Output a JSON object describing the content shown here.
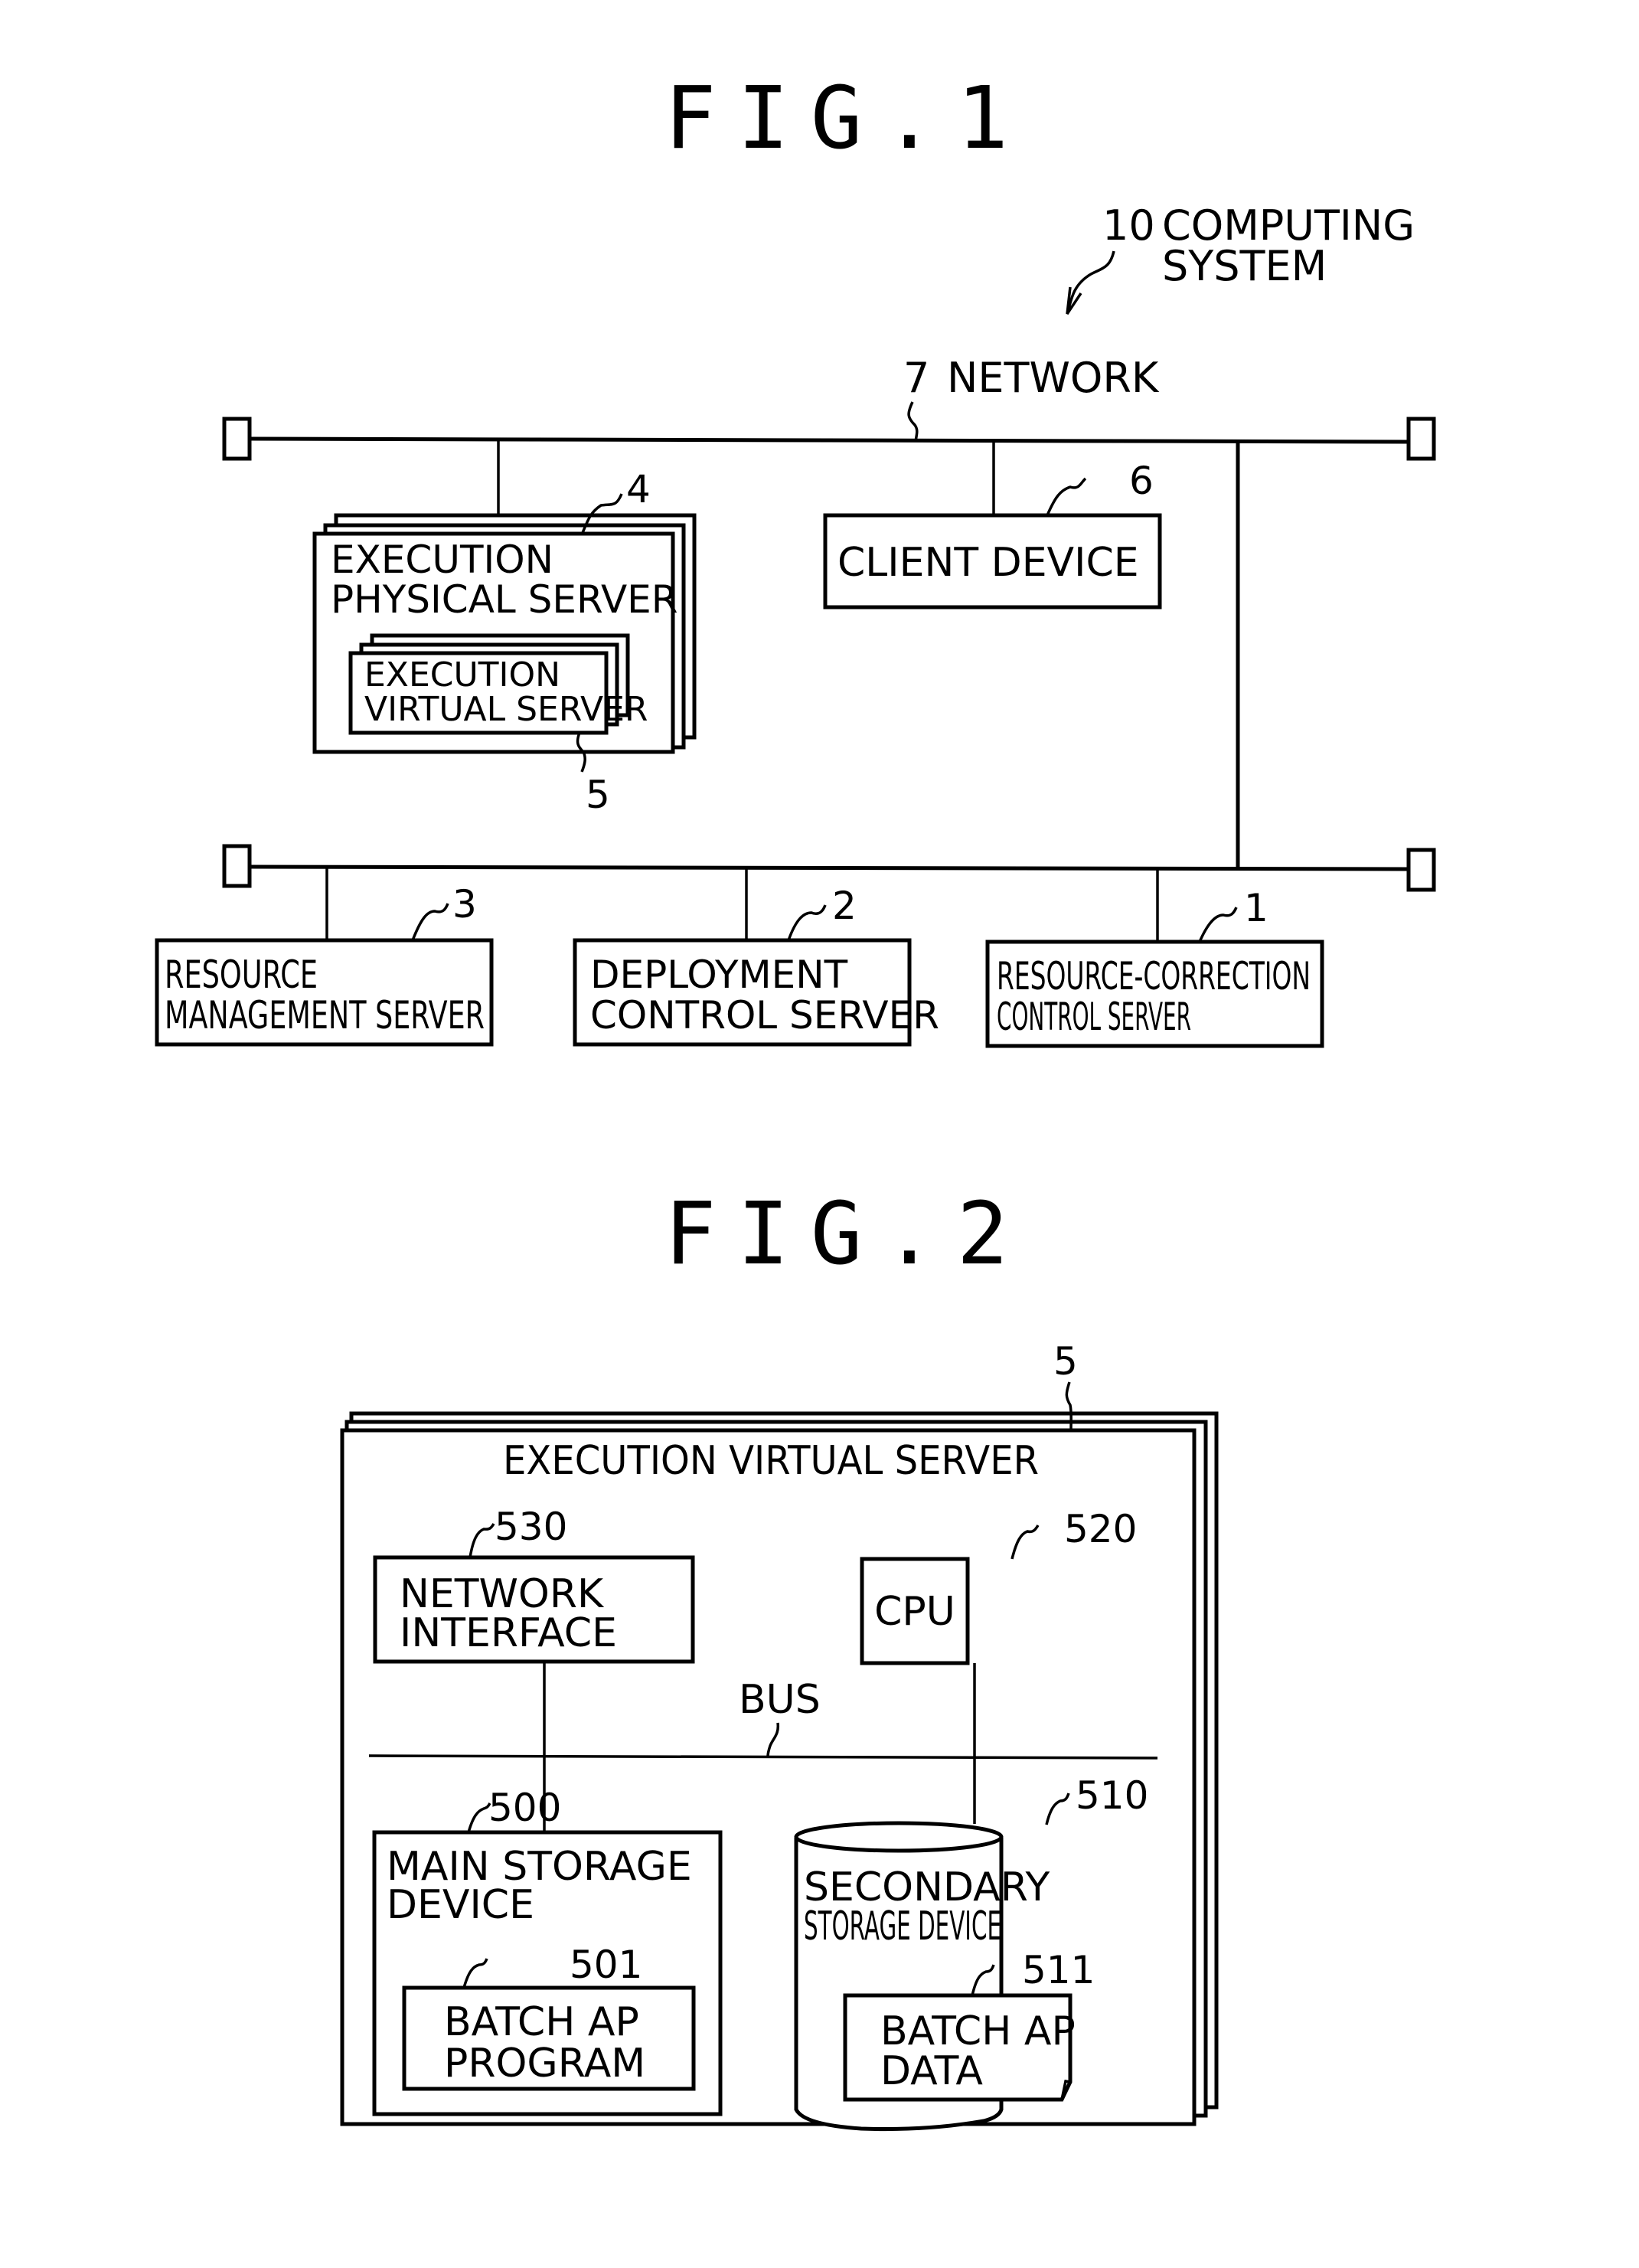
{
  "fig1": {
    "title": "FIG.1",
    "system": {
      "ref": "10",
      "label_line1": "COMPUTING",
      "label_line2": "SYSTEM"
    },
    "network": {
      "ref": "7",
      "label": "NETWORK"
    },
    "nodes": {
      "execution_physical_server": {
        "ref": "4",
        "line1": "EXECUTION",
        "line2": "PHYSICAL SERVER"
      },
      "execution_virtual_server": {
        "ref": "5",
        "line1": "EXECUTION",
        "line2": "VIRTUAL SERVER"
      },
      "client_device": {
        "ref": "6",
        "line1": "CLIENT DEVICE"
      },
      "resource_management_server": {
        "ref": "3",
        "line1": "RESOURCE",
        "line2": "MANAGEMENT SERVER"
      },
      "deployment_control_server": {
        "ref": "2",
        "line1": "DEPLOYMENT",
        "line2": "CONTROL SERVER"
      },
      "resource_correction_control_server": {
        "ref": "1",
        "line1": "RESOURCE-CORRECTION",
        "line2": "CONTROL SERVER"
      }
    }
  },
  "fig2": {
    "title": "FIG.2",
    "server": {
      "ref": "5",
      "label": "EXECUTION VIRTUAL SERVER"
    },
    "bus": {
      "label": "BUS"
    },
    "components": {
      "network_interface": {
        "ref": "530",
        "line1": "NETWORK",
        "line2": "INTERFACE"
      },
      "cpu": {
        "ref": "520",
        "line1": "CPU"
      },
      "main_storage": {
        "ref": "500",
        "line1": "MAIN STORAGE",
        "line2": "DEVICE"
      },
      "batch_ap_program": {
        "ref": "501",
        "line1": "BATCH AP",
        "line2": "PROGRAM"
      },
      "secondary_storage": {
        "ref": "510",
        "line1": "SECONDARY",
        "line2": "STORAGE DEVICE"
      },
      "batch_ap_data": {
        "ref": "511",
        "line1": "BATCH AP",
        "line2": "DATA"
      }
    }
  }
}
